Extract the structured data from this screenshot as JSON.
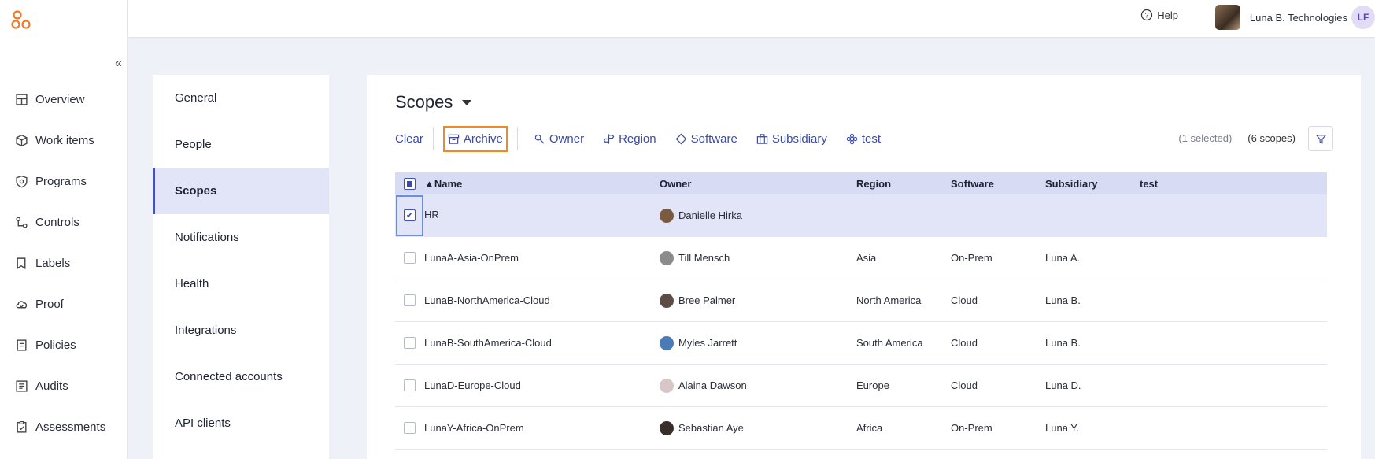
{
  "nav": {
    "items": [
      {
        "label": "Overview",
        "icon": "overview-icon"
      },
      {
        "label": "Work items",
        "icon": "work-items-icon"
      },
      {
        "label": "Programs",
        "icon": "programs-icon"
      },
      {
        "label": "Controls",
        "icon": "controls-icon"
      },
      {
        "label": "Labels",
        "icon": "labels-icon"
      },
      {
        "label": "Proof",
        "icon": "proof-icon"
      },
      {
        "label": "Policies",
        "icon": "policies-icon"
      },
      {
        "label": "Audits",
        "icon": "audits-icon"
      },
      {
        "label": "Assessments",
        "icon": "assessments-icon"
      }
    ]
  },
  "topbar": {
    "help_label": "Help",
    "org_name": "Luna B. Technologies",
    "user_initials": "LF"
  },
  "settings": {
    "items": [
      {
        "label": "General"
      },
      {
        "label": "People"
      },
      {
        "label": "Scopes",
        "active": true
      },
      {
        "label": "Notifications"
      },
      {
        "label": "Health"
      },
      {
        "label": "Integrations"
      },
      {
        "label": "Connected accounts"
      },
      {
        "label": "API clients"
      }
    ]
  },
  "main": {
    "title": "Scopes",
    "toolbar": {
      "clear": "Clear",
      "archive": "Archive",
      "owner": "Owner",
      "region": "Region",
      "software": "Software",
      "subsidiary": "Subsidiary",
      "test": "test"
    },
    "selected_text": "(1 selected)",
    "count_text": "(6 scopes)"
  },
  "table": {
    "headers": {
      "name": "▲Name",
      "owner": "Owner",
      "region": "Region",
      "software": "Software",
      "subsidiary": "Subsidiary",
      "test": "test"
    },
    "rows": [
      {
        "name": "HR",
        "owner": "Danielle Hirka",
        "region": "",
        "software": "",
        "subsidiary": "",
        "test": "",
        "selected": true
      },
      {
        "name": "LunaA-Asia-OnPrem",
        "owner": "Till Mensch",
        "region": "Asia",
        "software": "On-Prem",
        "subsidiary": "Luna A.",
        "test": ""
      },
      {
        "name": "LunaB-NorthAmerica-Cloud",
        "owner": "Bree Palmer",
        "region": "North America",
        "software": "Cloud",
        "subsidiary": "Luna B.",
        "test": ""
      },
      {
        "name": "LunaB-SouthAmerica-Cloud",
        "owner": "Myles Jarrett",
        "region": "South America",
        "software": "Cloud",
        "subsidiary": "Luna B.",
        "test": ""
      },
      {
        "name": "LunaD-Europe-Cloud",
        "owner": "Alaina Dawson",
        "region": "Europe",
        "software": "Cloud",
        "subsidiary": "Luna D.",
        "test": ""
      },
      {
        "name": "LunaY-Africa-OnPrem",
        "owner": "Sebastian Aye",
        "region": "Africa",
        "software": "On-Prem",
        "subsidiary": "Luna Y.",
        "test": ""
      }
    ]
  },
  "colors": {
    "accent": "#3b4aa8",
    "highlight": "#f08a24",
    "logo": "#f07a2a"
  }
}
